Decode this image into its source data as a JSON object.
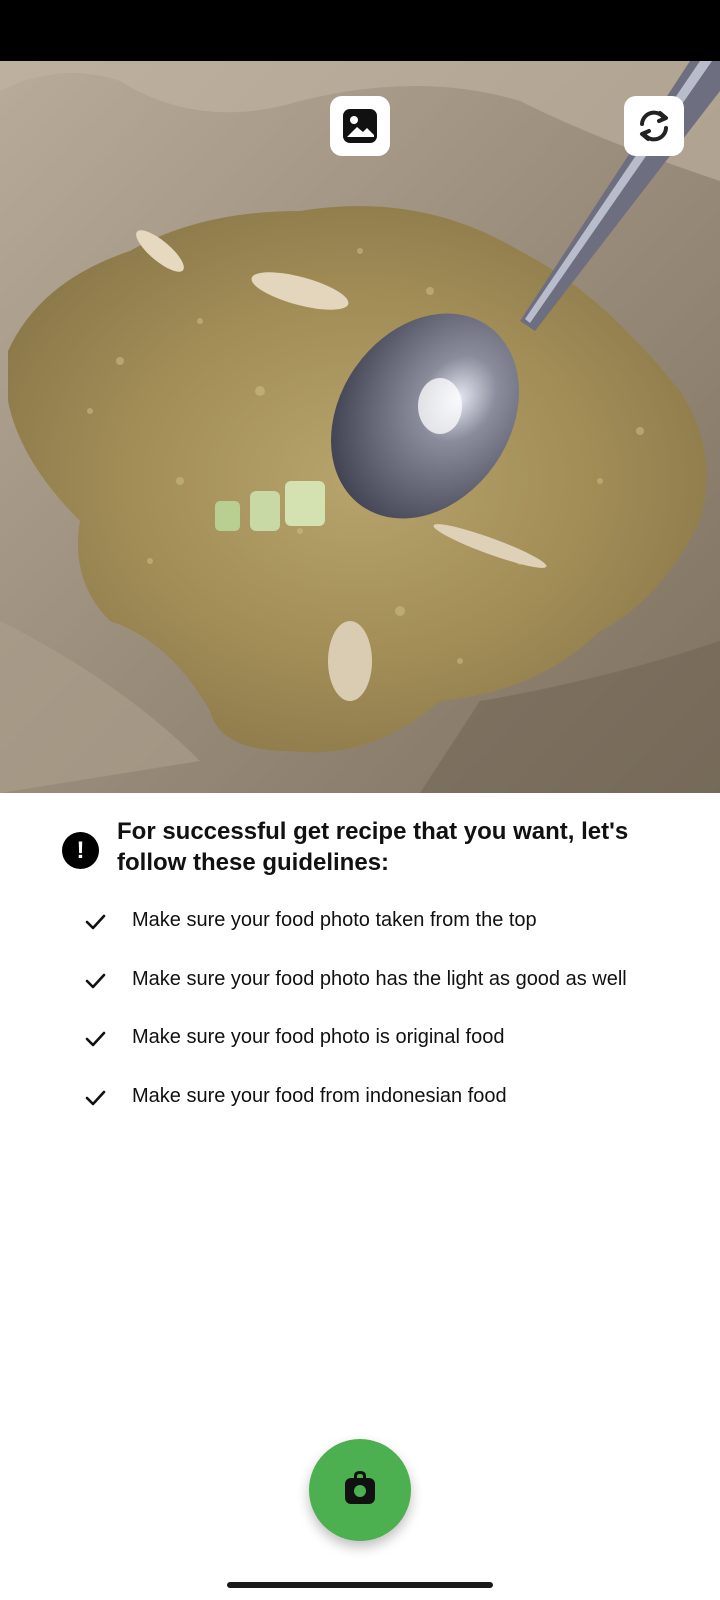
{
  "camera": {
    "gallery_icon": "image-icon",
    "switch_icon": "camera-switch-icon"
  },
  "guidelines": {
    "alert_icon": "exclamation-icon",
    "alert_symbol": "!",
    "title": "For successful get recipe that you want, let's follow these guidelines:",
    "items": [
      {
        "icon": "check-icon",
        "text": "Make sure your food photo taken from the top"
      },
      {
        "icon": "check-icon",
        "text": "Make sure your food photo has the light as good as well"
      },
      {
        "icon": "check-icon",
        "text": "Make sure your food photo is original food"
      },
      {
        "icon": "check-icon",
        "text": "Make sure your food from indonesian food"
      }
    ]
  },
  "capture": {
    "icon": "camera-icon",
    "color": "#4caf50"
  }
}
